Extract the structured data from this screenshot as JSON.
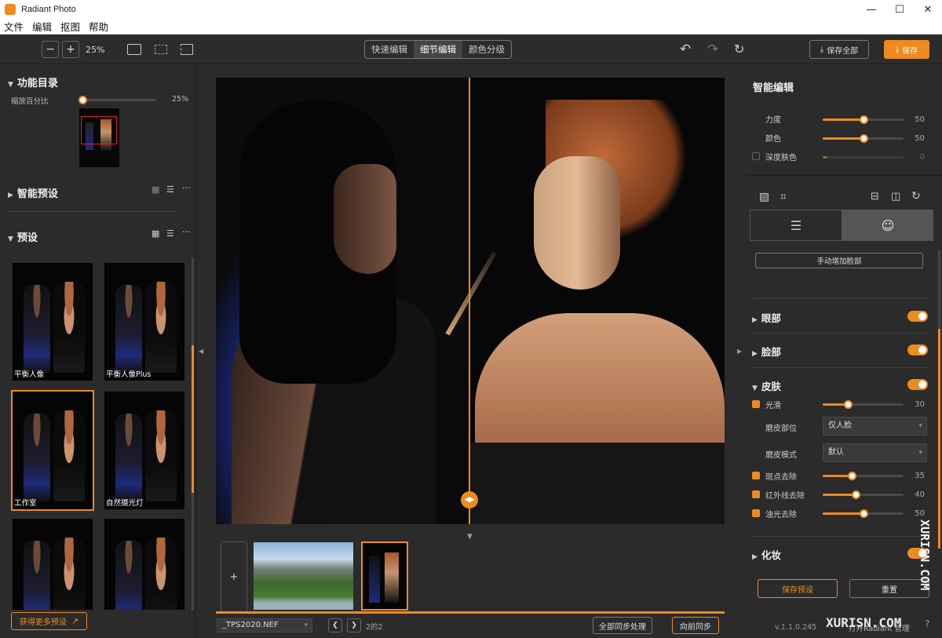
{
  "app": {
    "title": "Radiant Photo"
  },
  "window_controls": {
    "minimize": "—",
    "maximize": "☐",
    "close": "✕"
  },
  "menu": [
    "文件",
    "编辑",
    "抠图",
    "帮助"
  ],
  "toolbar": {
    "zoom_out": "−",
    "zoom_in": "+",
    "zoom_value": "25%",
    "modes": [
      "快速编辑",
      "细节编辑",
      "颜色分级"
    ],
    "active_mode": "细节编辑",
    "save_all_label": "保存全部",
    "save_label": "保存"
  },
  "left_panel": {
    "navigator": {
      "title": "功能目录",
      "scale_label": "缩放百分比",
      "scale_value": "25%",
      "scale_level": 0.04
    },
    "smart_presets": {
      "title": "智能预设"
    },
    "presets": {
      "title": "预设",
      "items": [
        {
          "label": "平衡人像"
        },
        {
          "label": "平衡人像Plus"
        },
        {
          "label": "工作室",
          "selected": true
        },
        {
          "label": "自然摄光灯"
        },
        {
          "label": ""
        },
        {
          "label": ""
        }
      ],
      "more_button": "获得更多预设"
    }
  },
  "filmstrip": {
    "add_label": "+",
    "file_select": "_TPS2020.NEF",
    "page_info": "2的2",
    "sync_all_button": "全部同步处理",
    "sync_forward_button": "向前同步"
  },
  "right_panel": {
    "title": "智能编辑",
    "sliders": [
      {
        "label": "力度",
        "value": 50
      },
      {
        "label": "颜色",
        "value": 50
      },
      {
        "label": "深度肤色",
        "value": 0
      }
    ],
    "add_face_button": "手动增加脸部",
    "sections": [
      {
        "label": "眼部",
        "enabled": true
      },
      {
        "label": "脸部",
        "enabled": true
      },
      {
        "label": "皮肤",
        "enabled": true
      },
      {
        "label": "化妆",
        "enabled": true
      }
    ],
    "skin": {
      "smooth": {
        "label": "光滑",
        "value": 30
      },
      "area_label": "磨皮部位",
      "area_value": "仅人脸",
      "mode_label": "磨皮模式",
      "mode_value": "默认",
      "spot": {
        "label": "斑点去除",
        "value": 35
      },
      "infrared": {
        "label": "红外线去除",
        "value": 40
      },
      "shine": {
        "label": "油光去除",
        "value": 50
      }
    },
    "save_preset_button": "保存预设",
    "reset_button": "重置",
    "version": "v.1.1.0.245",
    "open_manager": "打开Radiant 管理"
  },
  "watermark": {
    "vertical": "XURISN.COM",
    "bottom": "XURISN.COM"
  },
  "colors": {
    "accent": "#ee8a1e",
    "panel": "#2b2b2b"
  }
}
